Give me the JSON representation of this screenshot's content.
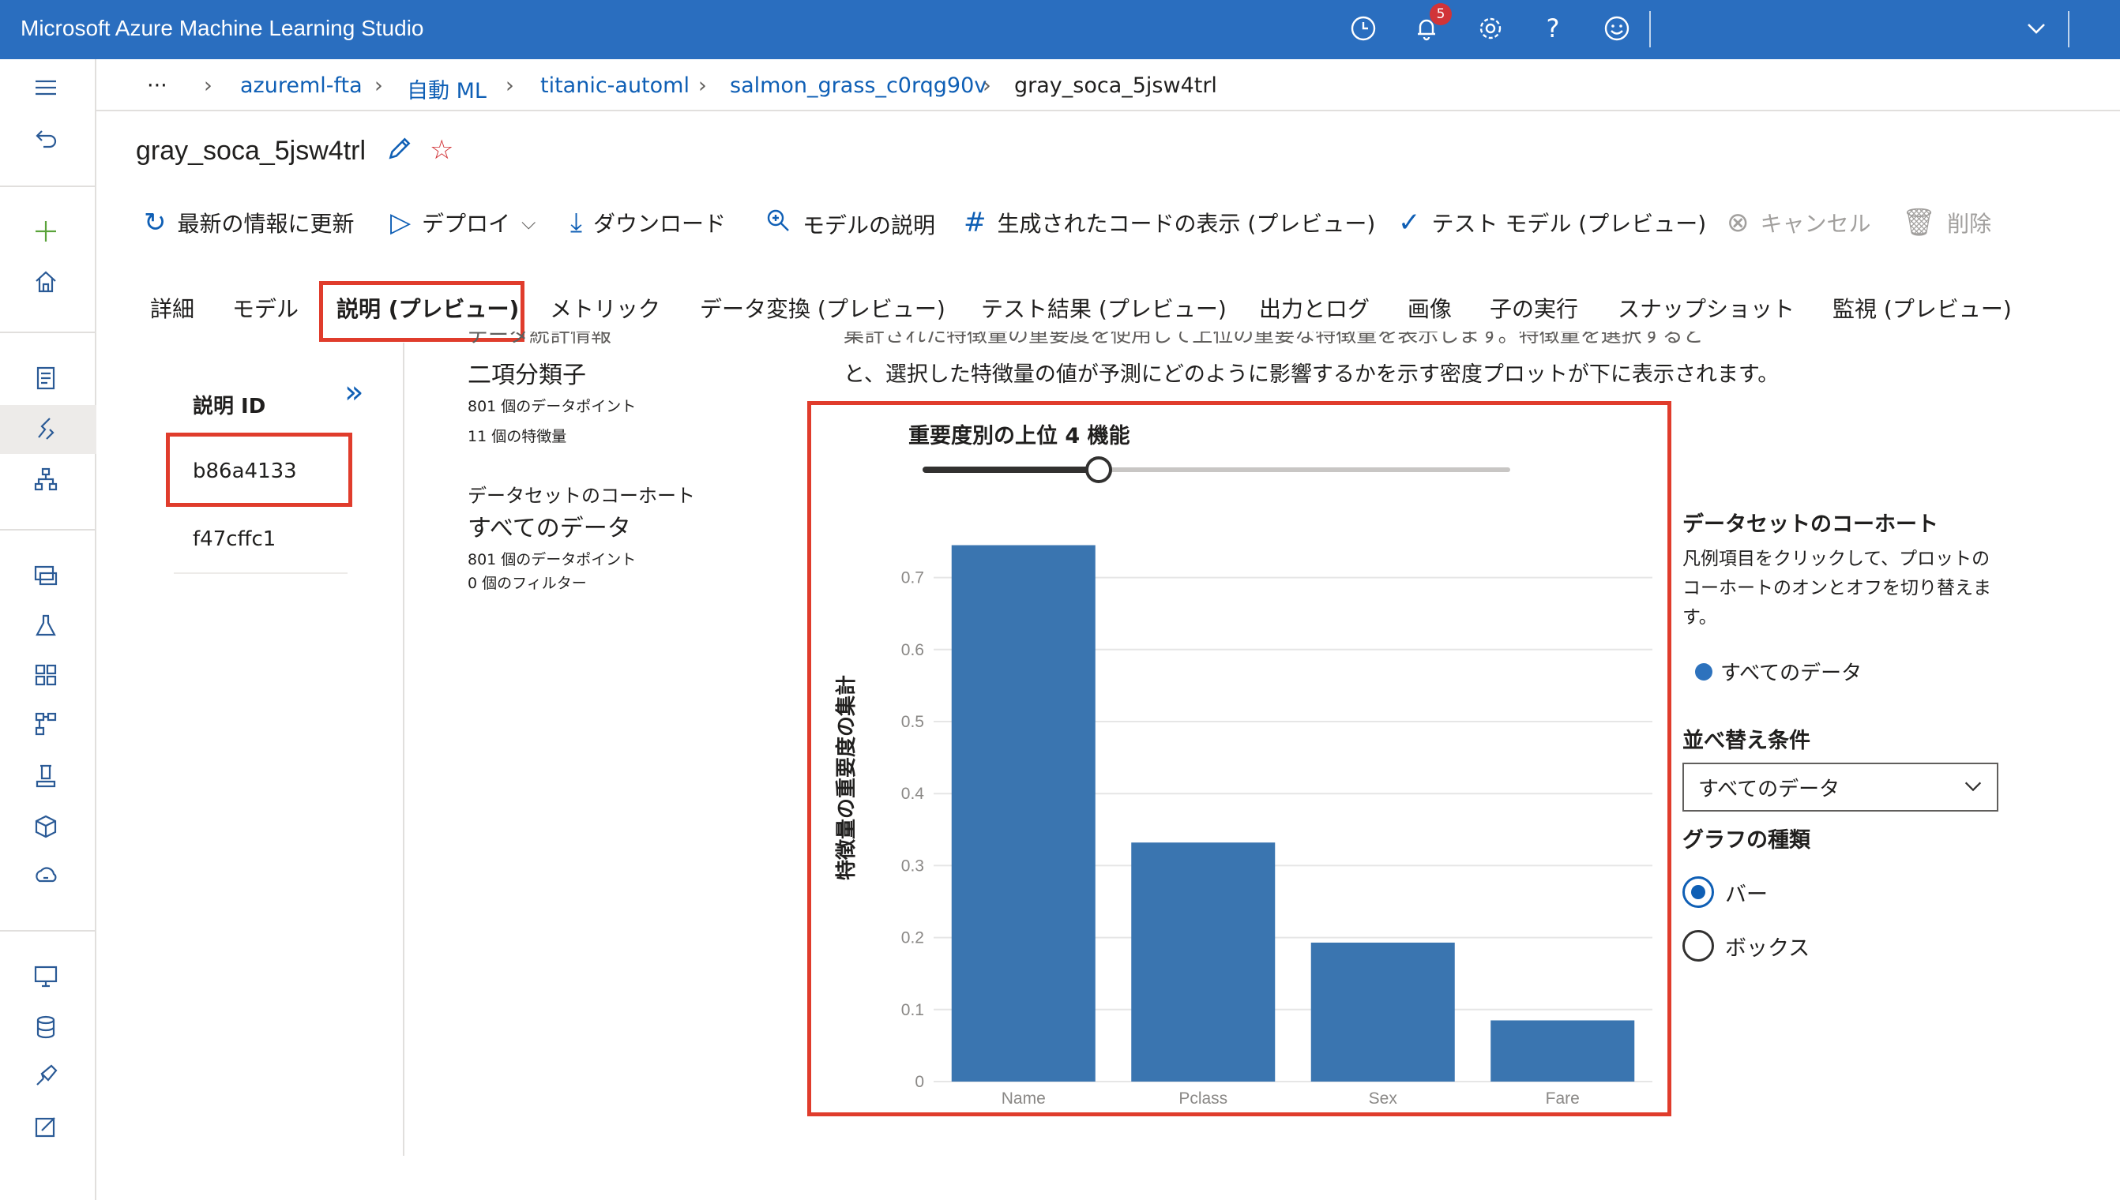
{
  "app": {
    "title": "Microsoft Azure Machine Learning Studio",
    "notification_count": "5"
  },
  "breadcrumb": {
    "more": "···",
    "items": [
      "azureml-fta",
      "自動 ML",
      "titanic-automl",
      "salmon_grass_c0rqg90v",
      "gray_soca_5jsw4trl"
    ]
  },
  "page": {
    "title": "gray_soca_5jsw4trl"
  },
  "toolbar": {
    "refresh": "最新の情報に更新",
    "deploy": "デプロイ",
    "download": "ダウンロード",
    "explain": "モデルの説明",
    "code": "生成されたコードの表示 (プレビュー)",
    "test": "テスト モデル (プレビュー)",
    "cancel": "キャンセル",
    "delete": "削除"
  },
  "tabs": [
    "詳細",
    "モデル",
    "説明 (プレビュー)",
    "メトリック",
    "データ変換 (プレビュー)",
    "テスト結果 (プレビュー)",
    "出力とログ",
    "画像",
    "子の実行",
    "スナップショット",
    "監視 (プレビュー)"
  ],
  "explanations": {
    "header": "説明 ID",
    "items": [
      "b86a4133",
      "f47cffc1"
    ]
  },
  "model_info": {
    "cut_text": "データ統計情報",
    "task_type": "二項分類子",
    "data_points": "801 個のデータポイント",
    "features": "11 個の特徴量",
    "cohort_label": "データセットのコーホート",
    "cohort_name": "すべてのデータ",
    "cohort_points": "801 個のデータポイント",
    "cohort_filters": "0 個のフィルター"
  },
  "description": {
    "cut_text": "集計された特徴量の重要度を使用して上位の重要な特徴量を表示します。特徴量を選択すると",
    "line": "と、選択した特徴量の値が予測にどのように影響するかを示す密度プロットが下に表示されます。"
  },
  "slider": {
    "label": "重要度別の上位 4 機能",
    "value": 4,
    "max": 11
  },
  "chart_data": {
    "type": "bar",
    "title": "",
    "categories": [
      "Name",
      "Pclass",
      "Sex",
      "Fare"
    ],
    "values": [
      0.745,
      0.332,
      0.193,
      0.085
    ],
    "xlabel": "",
    "ylabel": "特徴量の重要度の集計",
    "ylim": [
      0,
      0.75
    ],
    "yticks": [
      0,
      0.1,
      0.2,
      0.3,
      0.4,
      0.5,
      0.6,
      0.7
    ],
    "grid": true,
    "bar_color": "#3a75b0"
  },
  "right_panel": {
    "cohort_heading": "データセットのコーホート",
    "cohort_help": "凡例項目をクリックして、プロットのコーホートのオンとオフを切り替えます。",
    "legend_item": "すべてのデータ",
    "sort_heading": "並べ替え条件",
    "sort_value": "すべてのデータ",
    "chart_type_heading": "グラフの種類",
    "chart_options": [
      "バー",
      "ボックス"
    ]
  },
  "colors": {
    "topbar": "#2a6ebf",
    "accent": "#0f5fb5",
    "highlight": "#e03c2c"
  }
}
